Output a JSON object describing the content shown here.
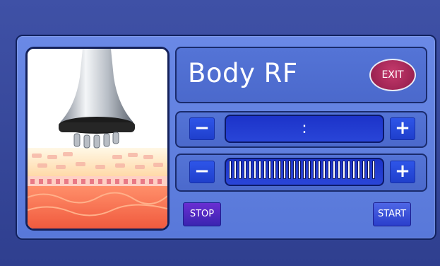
{
  "header": {
    "title": "Body RF",
    "exit_label": "EXIT"
  },
  "timer": {
    "minus_label": "−",
    "plus_label": "+",
    "value": ":"
  },
  "level": {
    "minus_label": "−",
    "plus_label": "+",
    "value": 30,
    "max": 30
  },
  "actions": {
    "stop_label": "STOP",
    "start_label": "START"
  },
  "colors": {
    "accent": "#2e55e8",
    "panel": "#6a89e6",
    "exit": "#a8295a"
  },
  "image": {
    "icon": "rf-probe-skin-illustration"
  }
}
